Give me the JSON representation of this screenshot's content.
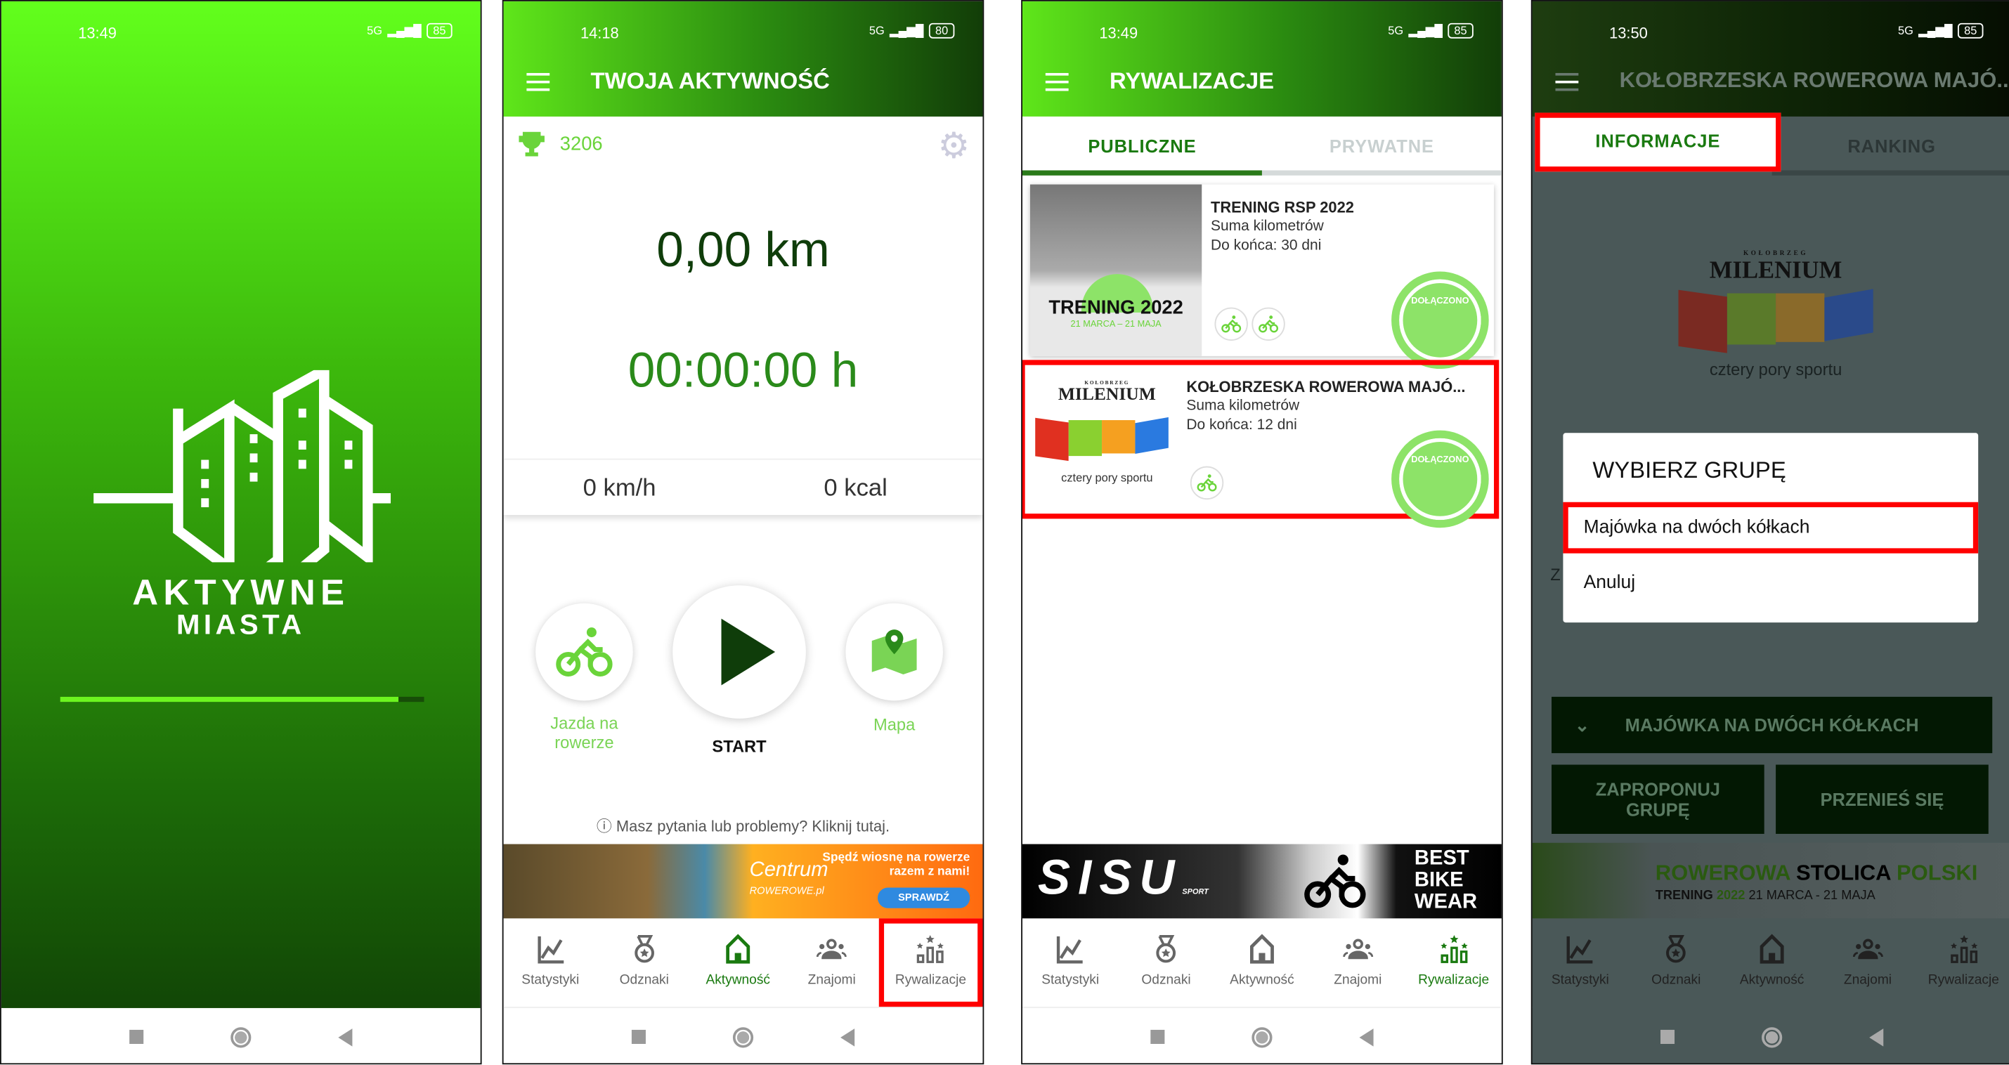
{
  "colors": {
    "brand_light": "#5fe61a",
    "brand_dark": "#123d08",
    "accent_text": "#1a7a10",
    "highlight": "#ff0000"
  },
  "nav": [
    "Statystyki",
    "Odznaki",
    "Aktywność",
    "Znajomi",
    "Rywalizacje"
  ],
  "splash": {
    "time": "13:49",
    "battery": "85",
    "network": "5G",
    "brand_line1": "AKTYWNE",
    "brand_line2": "MIASTA",
    "loading_progress": 0.93
  },
  "activity": {
    "time": "14:18",
    "battery": "80",
    "network": "5G",
    "title": "TWOJA AKTYWNOŚĆ",
    "points": "3206",
    "distance": "0,00 km",
    "duration": "00:00:00 h",
    "speed": "0 km/h",
    "calories": "0 kcal",
    "mode_label": "Jazda na rowerze",
    "start_label": "START",
    "map_label": "Mapa",
    "help": "Masz pytania lub problemy? Kliknij tutaj.",
    "ad": {
      "brand": "Centrum",
      "brand_sub": "ROWEROWE.pl",
      "headline": "Spędź wiosnę na rowerze razem z nami!",
      "cta": "SPRAWDŹ"
    },
    "active_nav": "Aktywność"
  },
  "competitions": {
    "time": "13:49",
    "battery": "85",
    "network": "5G",
    "title": "RYWALIZACJE",
    "tabs": [
      "PUBLICZNE",
      "PRYWATNE"
    ],
    "active_tab": "PUBLICZNE",
    "cards": [
      {
        "title": "TRENING RSP 2022",
        "type": "Suma kilometrów",
        "remaining": "Do końca: 30 dni",
        "image_title": "TRENING 2022",
        "image_dates": "21 MARCA – 21 MAJA",
        "badge": "DOŁĄCZONO"
      },
      {
        "title": "KOŁOBRZESKA ROWEROWA MAJÓ...",
        "type": "Suma kilometrów",
        "remaining": "Do końca: 12 dni",
        "image_brand_top": "KOŁOBRZEG",
        "image_brand": "MILENIUM",
        "image_caption": "cztery pory sportu",
        "badge": "DOŁĄCZONO"
      }
    ],
    "ad": {
      "brand": "SISU",
      "brand_sub": "SPORT",
      "slogan": "BEST BIKE WEAR"
    },
    "active_nav": "Rywalizacje"
  },
  "detail": {
    "time": "13:50",
    "battery": "85",
    "network": "5G",
    "title": "KOŁOBRZESKA ROWEROWA MAJÓ...",
    "tabs": [
      "INFORMACJE",
      "RANKING"
    ],
    "logo_top": "KOŁOBRZEG",
    "logo": "MILENIUM",
    "logo_caption": "cztery pory sportu",
    "peek_text": "Z",
    "dialog": {
      "title": "WYBIERZ GRUPĘ",
      "option": "Majówka na dwóch kółkach",
      "cancel": "Anuluj"
    },
    "group_select": "MAJÓWKA NA DWÓCH KÓŁKACH",
    "propose": "ZAPROPONUJ GRUPĘ",
    "move": "PRZENIEŚ SIĘ",
    "banner": {
      "w1": "ROWEROWA",
      "w2": "STOLICA",
      "w3": "POLSKI",
      "t1": "TRENING",
      "t2": "2022",
      "dates": "21 MARCA - 21 MAJA"
    }
  }
}
